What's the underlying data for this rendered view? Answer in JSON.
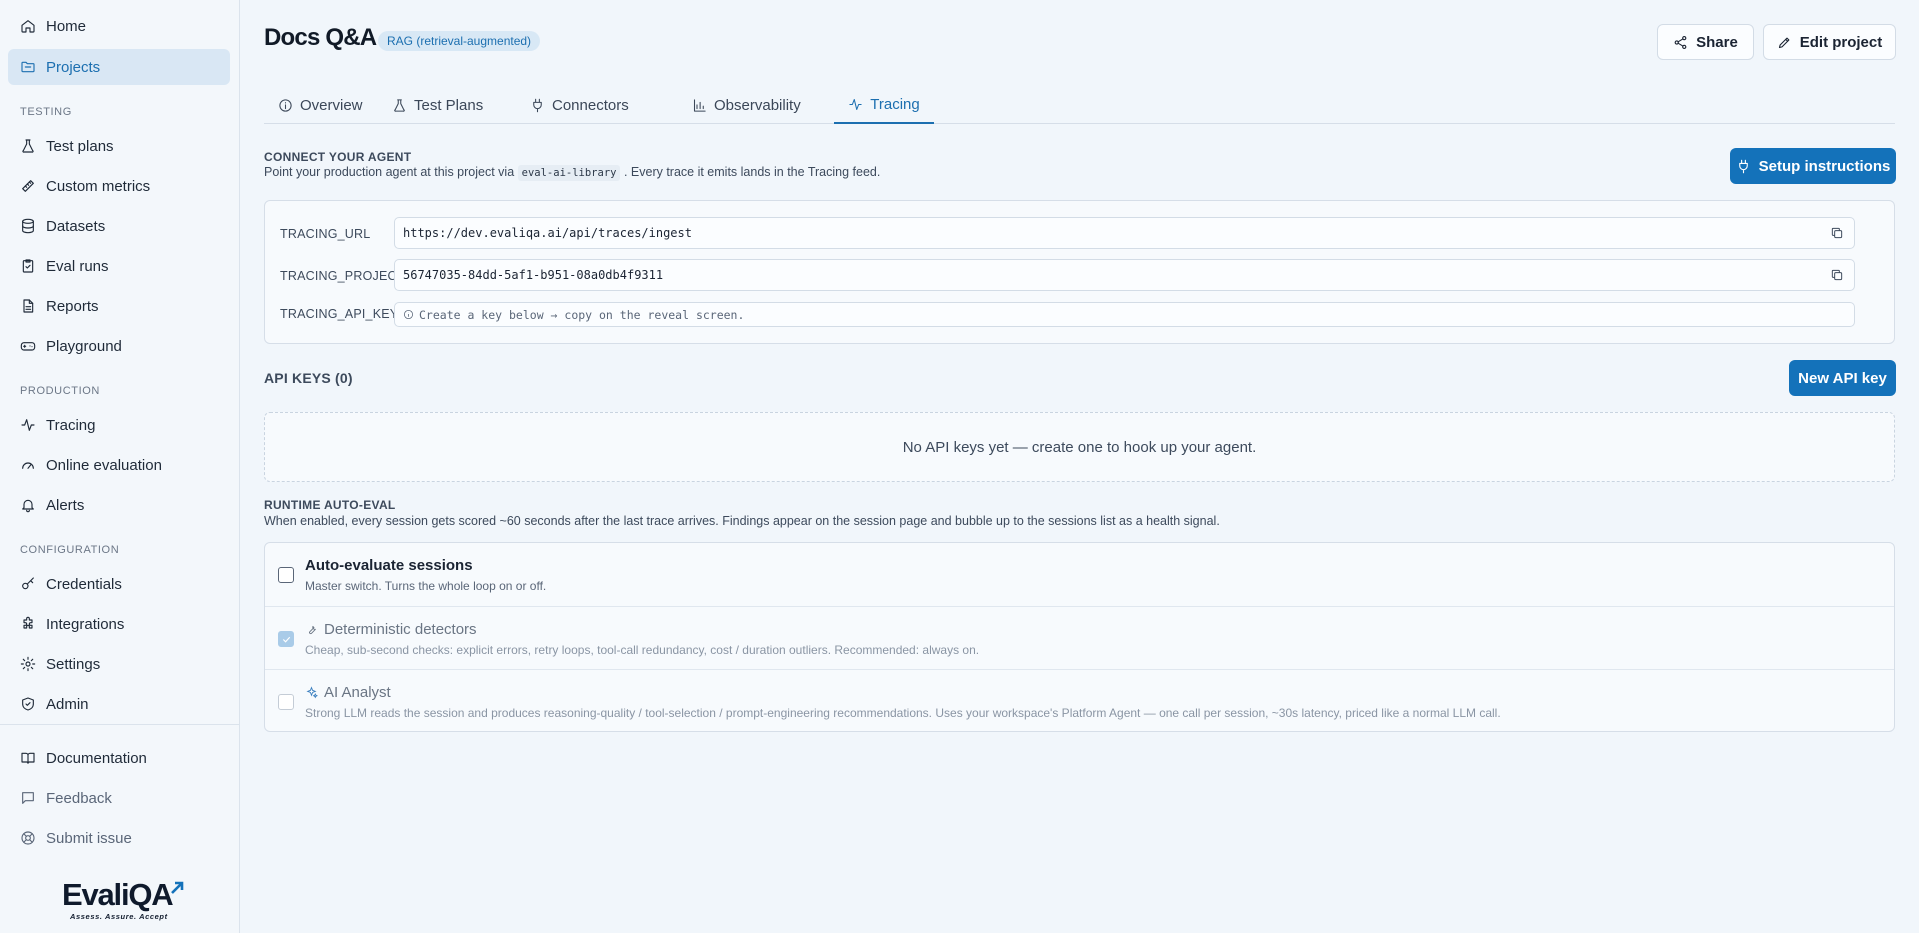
{
  "sidebar": {
    "home": "Home",
    "projects": "Projects",
    "sections": {
      "testing": "TESTING",
      "production": "PRODUCTION",
      "configuration": "CONFIGURATION"
    },
    "testing_items": [
      "Test plans",
      "Custom metrics",
      "Datasets",
      "Eval runs",
      "Reports",
      "Playground"
    ],
    "production_items": [
      "Tracing",
      "Online evaluation",
      "Alerts"
    ],
    "configuration_items": [
      "Credentials",
      "Integrations",
      "Settings",
      "Admin"
    ],
    "footer_items": [
      "Documentation",
      "Feedback",
      "Submit issue"
    ],
    "logo": {
      "word": "EvaliQA",
      "tagline": "Assess. Assure. Accept"
    }
  },
  "header": {
    "title": "Docs Q&A",
    "badge": "RAG (retrieval-augmented)",
    "share_label": "Share",
    "edit_label": "Edit project"
  },
  "tabs": [
    {
      "label": "Overview",
      "icon": "info-icon"
    },
    {
      "label": "Test Plans",
      "icon": "flask-icon"
    },
    {
      "label": "Connectors",
      "icon": "plug-icon"
    },
    {
      "label": "Observability",
      "icon": "bar-chart-icon"
    },
    {
      "label": "Tracing",
      "icon": "activity-icon",
      "active": true
    }
  ],
  "connect": {
    "title": "CONNECT YOUR AGENT",
    "desc_before": "Point your production agent at this project via",
    "desc_code": "eval-ai-library",
    "desc_after": ". Every trace it emits lands in the Tracing feed.",
    "setup_label": "Setup instructions",
    "env": [
      {
        "key": "TRACING_URL",
        "value": "https://dev.evaliqa.ai/api/traces/ingest"
      },
      {
        "key": "TRACING_PROJECT",
        "value": "56747035-84dd-5af1-b951-08a0db4f9311"
      },
      {
        "key": "TRACING_API_KEY",
        "hint": "Create a key below → copy on the reveal screen."
      }
    ]
  },
  "api_keys": {
    "title": "API KEYS (0)",
    "new_label": "New API key",
    "empty": "No API keys yet — create one to hook up your agent."
  },
  "runtime": {
    "title": "RUNTIME AUTO-EVAL",
    "desc": "When enabled, every session gets scored ~60 seconds after the last trace arrives. Findings appear on the session page and bubble up to the sessions list as a health signal.",
    "options": [
      {
        "title": "Auto-evaluate sessions",
        "desc": "Master switch. Turns the whole loop on or off.",
        "checked": false
      },
      {
        "title": "Deterministic detectors",
        "desc": "Cheap, sub-second checks: explicit errors, retry loops, tool-call redundancy, cost / duration outliers. Recommended: always on.",
        "checked": true
      },
      {
        "title": "AI Analyst",
        "desc": "Strong LLM reads the session and produces reasoning-quality / tool-selection / prompt-engineering recommendations. Uses your workspace's Platform Agent — one call per session, ~30s latency, priced like a normal LLM call.",
        "checked": false
      }
    ]
  },
  "colors": {
    "accent": "#1472ba",
    "active_bg": "#d9e7f4"
  }
}
